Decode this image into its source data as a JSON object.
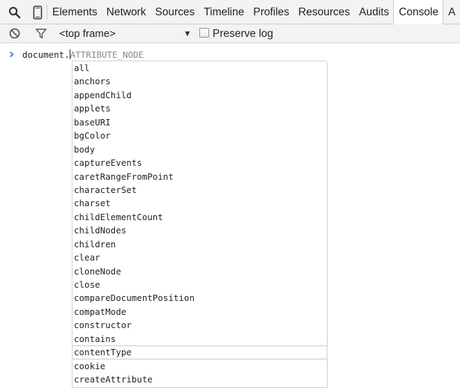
{
  "toolbar_tabs": {
    "tabs": [
      "Elements",
      "Network",
      "Sources",
      "Timeline",
      "Profiles",
      "Resources",
      "Audits",
      "Console",
      "A"
    ],
    "active_tab": "Console"
  },
  "console_toolbar": {
    "frame_select": "<top frame>",
    "preserve_log_label": "Preserve log",
    "preserve_log_checked": false
  },
  "console": {
    "typed_text": "document.",
    "ghost_completion": "ATTRIBUTE_NODE"
  },
  "autocomplete": {
    "selected": "contentType",
    "items": [
      "all",
      "anchors",
      "appendChild",
      "applets",
      "baseURI",
      "bgColor",
      "body",
      "captureEvents",
      "caretRangeFromPoint",
      "characterSet",
      "charset",
      "childElementCount",
      "childNodes",
      "children",
      "clear",
      "cloneNode",
      "close",
      "compareDocumentPosition",
      "compatMode",
      "constructor",
      "contains",
      "contentType",
      "cookie",
      "createAttribute"
    ]
  },
  "colors": {
    "prompt_chevron": "#2c7be5",
    "ghost_text": "#8a8a8a",
    "toolbar_bg": "#f3f3f3"
  }
}
